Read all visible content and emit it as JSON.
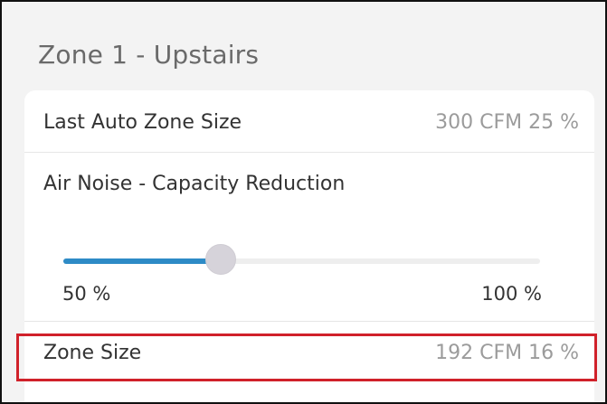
{
  "zone": {
    "title": "Zone 1 - Upstairs"
  },
  "settings": {
    "last_auto_zone_size": {
      "label": "Last Auto Zone Size",
      "value": "300 CFM 25 %"
    },
    "air_noise": {
      "label": "Air Noise - Capacity Reduction",
      "min_label": "50 %",
      "max_label": "100 %",
      "level_fraction": 0.33
    },
    "zone_size": {
      "label": "Zone Size",
      "value": "192 CFM 16 %"
    }
  },
  "colors": {
    "accent": "#2e8bc6",
    "highlight": "#d0212a",
    "thumb": "#d6d3da"
  }
}
